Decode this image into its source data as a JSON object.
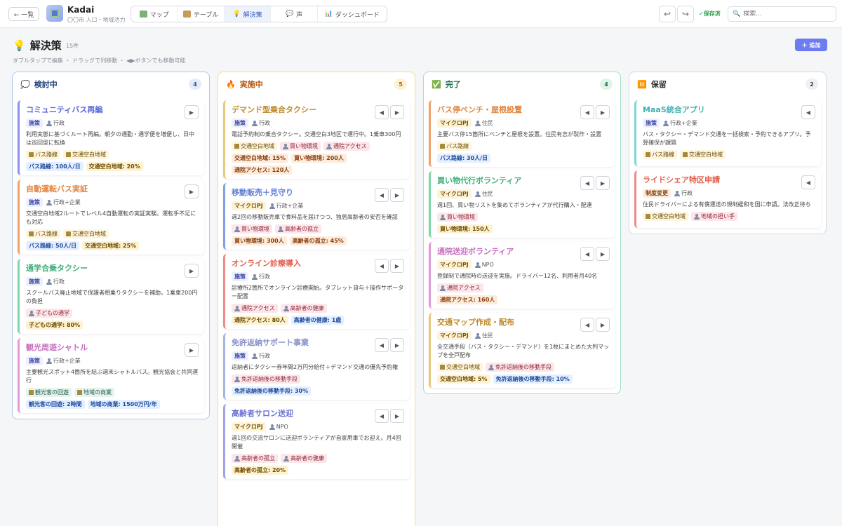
{
  "header": {
    "back_label": "← 一覧",
    "app_title": "Kadai",
    "app_sub": "〇〇市 人口・地域活力",
    "tabs": [
      {
        "label": "マップ",
        "icon": "map-icon"
      },
      {
        "label": "テーブル",
        "icon": "table-icon"
      },
      {
        "label": "解決策",
        "icon": "lightbulb-icon"
      },
      {
        "label": "声",
        "icon": "speech-icon"
      },
      {
        "label": "ダッシュボード",
        "icon": "chart-icon"
      }
    ],
    "undo": "↩",
    "redo": "↪",
    "save_status": "✓保存済",
    "search_placeholder": "検索..."
  },
  "page": {
    "icon": "💡",
    "title": "解決策",
    "count": "15件",
    "hint": "ダブルタップで編集 ・ ドラッグで列移動 ・ ◀▶ボタンでも移動可能",
    "add_label": "＋ 追加"
  },
  "columns": [
    {
      "icon": "💭",
      "title": "検討中",
      "count": "4",
      "cards": [
        {
          "title": "コミュニティバス再編",
          "type": "施策",
          "actor": "行政",
          "desc": "利用実態に基づくルート再編。朝夕の通勤・通学便を増便し、日中は巡回型に転換",
          "issues": [
            [
              "bldg",
              "バス路線"
            ],
            [
              "bldg",
              "交通空白地域"
            ]
          ],
          "metrics": [
            [
              "blue",
              "バス路線: 100人/日"
            ],
            [
              "yellow",
              "交通空白地域: 20%"
            ]
          ]
        },
        {
          "title": "自動運転バス実証",
          "type": "施策",
          "actor": "行政+企業",
          "desc": "交通空白地域2ルートでレベル4自動運転の実証実験。運転手不足にも対応",
          "issues": [
            [
              "bldg",
              "バス路線"
            ],
            [
              "bldg",
              "交通空白地域"
            ]
          ],
          "metrics": [
            [
              "blue",
              "バス路線: 50人/日"
            ],
            [
              "yellow",
              "交通空白地域: 25%"
            ]
          ]
        },
        {
          "title": "通学合乗タクシー",
          "type": "施策",
          "actor": "行政",
          "desc": "スクールバス廃止地域で保護者相乗りタクシーを補助。1乗車200円の負担",
          "issues": [
            [
              "person",
              "子どもの通学"
            ]
          ],
          "metrics": [
            [
              "yellow",
              "子どもの通学: 80%"
            ]
          ]
        },
        {
          "title": "観光周遊シャトル",
          "type": "施策",
          "actor": "行政+企業",
          "desc": "主要観光スポット4箇所を結ぶ週末シャトルバス。観光協会と共同運行",
          "issues": [
            [
              "teal",
              "観光客の回遊"
            ],
            [
              "teal",
              "地域の商業"
            ]
          ],
          "metrics": [
            [
              "blue",
              "観光客の回遊: 2時間"
            ],
            [
              "blue",
              "地域の商業: 1500万円/年"
            ]
          ]
        }
      ]
    },
    {
      "icon": "🔥",
      "title": "実施中",
      "count": "5",
      "cards": [
        {
          "title": "デマンド型乗合タクシー",
          "type": "施策",
          "actor": "行政",
          "desc": "電話予約制の乗合タクシー。交通空白3地区で運行中。1乗車300円",
          "issues": [
            [
              "bldg",
              "交通空白地域"
            ],
            [
              "person",
              "買い物環境"
            ],
            [
              "person",
              "通院アクセス"
            ]
          ],
          "metrics": [
            [
              "orange",
              "交通空白地域: 15%"
            ],
            [
              "orange",
              "買い物環境: 200人"
            ],
            [
              "orange",
              "通院アクセス: 120人"
            ]
          ]
        },
        {
          "title": "移動販売＋見守り",
          "type": "マイクロPJ",
          "actor": "行政+企業",
          "desc": "週2回の移動販売車で食料品を届けつつ、独居高齢者の安否を確認",
          "issues": [
            [
              "person",
              "買い物環境"
            ],
            [
              "person",
              "高齢者の孤立"
            ]
          ],
          "metrics": [
            [
              "orange",
              "買い物環境: 300人"
            ],
            [
              "orange",
              "高齢者の孤立: 45%"
            ]
          ]
        },
        {
          "title": "オンライン診療導入",
          "type": "施策",
          "actor": "行政",
          "desc": "診療所2箇所でオンライン診療開始。タブレット貸与＋操作サポーター配置",
          "issues": [
            [
              "person",
              "通院アクセス"
            ],
            [
              "person",
              "高齢者の健康"
            ]
          ],
          "metrics": [
            [
              "yellow",
              "通院アクセス: 80人"
            ],
            [
              "blue",
              "高齢者の健康: 1歳"
            ]
          ]
        },
        {
          "title": "免許返納サポート事業",
          "type": "施策",
          "actor": "行政",
          "desc": "返納者にタクシー券年間2万円分給付＋デマンド交通の優先予約権",
          "issues": [
            [
              "person",
              "免許返納後の移動手段"
            ]
          ],
          "metrics": [
            [
              "blue",
              "免許返納後の移動手段: 30%"
            ]
          ]
        },
        {
          "title": "高齢者サロン送迎",
          "type": "マイクロPJ",
          "actor": "NPO",
          "desc": "週1回の交流サロンに送迎ボランティアが自家用車でお迎え。月4回開催",
          "issues": [
            [
              "person",
              "高齢者の孤立"
            ],
            [
              "person",
              "高齢者の健康"
            ]
          ],
          "metrics": [
            [
              "yellow",
              "高齢者の孤立: 20%"
            ]
          ]
        }
      ]
    },
    {
      "icon": "✅",
      "title": "完了",
      "count": "4",
      "cards": [
        {
          "title": "バス停ベンチ・屋根設置",
          "type": "マイクロPJ",
          "actor": "住民",
          "desc": "主要バス停15箇所にベンチと屋根を設置。住民有志が製作・設置",
          "issues": [
            [
              "bldg",
              "バス路線"
            ]
          ],
          "metrics": [
            [
              "blue",
              "バス路線: 30人/日"
            ]
          ]
        },
        {
          "title": "買い物代行ボランティア",
          "type": "マイクロPJ",
          "actor": "住民",
          "desc": "週1回、買い物リストを集めてボランティアが代行購入・配達",
          "issues": [
            [
              "person",
              "買い物環境"
            ]
          ],
          "metrics": [
            [
              "yellow",
              "買い物環境: 150人"
            ]
          ]
        },
        {
          "title": "通院送迎ボランティア",
          "type": "マイクロPJ",
          "actor": "NPO",
          "desc": "登録制で通院時の送迎を実施。ドライバー12名、利用者月40名",
          "issues": [
            [
              "person",
              "通院アクセス"
            ]
          ],
          "metrics": [
            [
              "orange",
              "通院アクセス: 160人"
            ]
          ]
        },
        {
          "title": "交通マップ作成・配布",
          "type": "マイクロPJ",
          "actor": "住民",
          "desc": "全交通手段（バス・タクシー・デマンド）を1枚にまとめた大判マップを全戸配布",
          "issues": [
            [
              "bldg",
              "交通空白地域"
            ],
            [
              "person",
              "免許返納後の移動手段"
            ]
          ],
          "metrics": [
            [
              "yellow",
              "交通空白地域: 5%"
            ],
            [
              "blue",
              "免許返納後の移動手段: 10%"
            ]
          ]
        }
      ]
    },
    {
      "icon": "⏸️",
      "title": "保留",
      "count": "2",
      "cards": [
        {
          "title": "MaaS統合アプリ",
          "type": "施策",
          "actor": "行政+企業",
          "desc": "バス・タクシー・デマンド交通を一括検索・予約できるアプリ。予算確保が課題",
          "issues": [
            [
              "bldg",
              "バス路線"
            ],
            [
              "bldg",
              "交通空白地域"
            ]
          ],
          "metrics": []
        },
        {
          "title": "ライドシェア特区申請",
          "type": "制度変更",
          "actor": "行政",
          "desc": "住民ドライバーによる有償運送の規制緩和を国に申請。法改正待ち",
          "issues": [
            [
              "bldg",
              "交通空白地域"
            ],
            [
              "person",
              "地域の担い手"
            ]
          ],
          "metrics": []
        }
      ]
    }
  ],
  "colors": {
    "col1": "#8fb6ea",
    "col2": "#f5d27a",
    "col3": "#8ed9b6",
    "col4": "#d6d9df"
  }
}
